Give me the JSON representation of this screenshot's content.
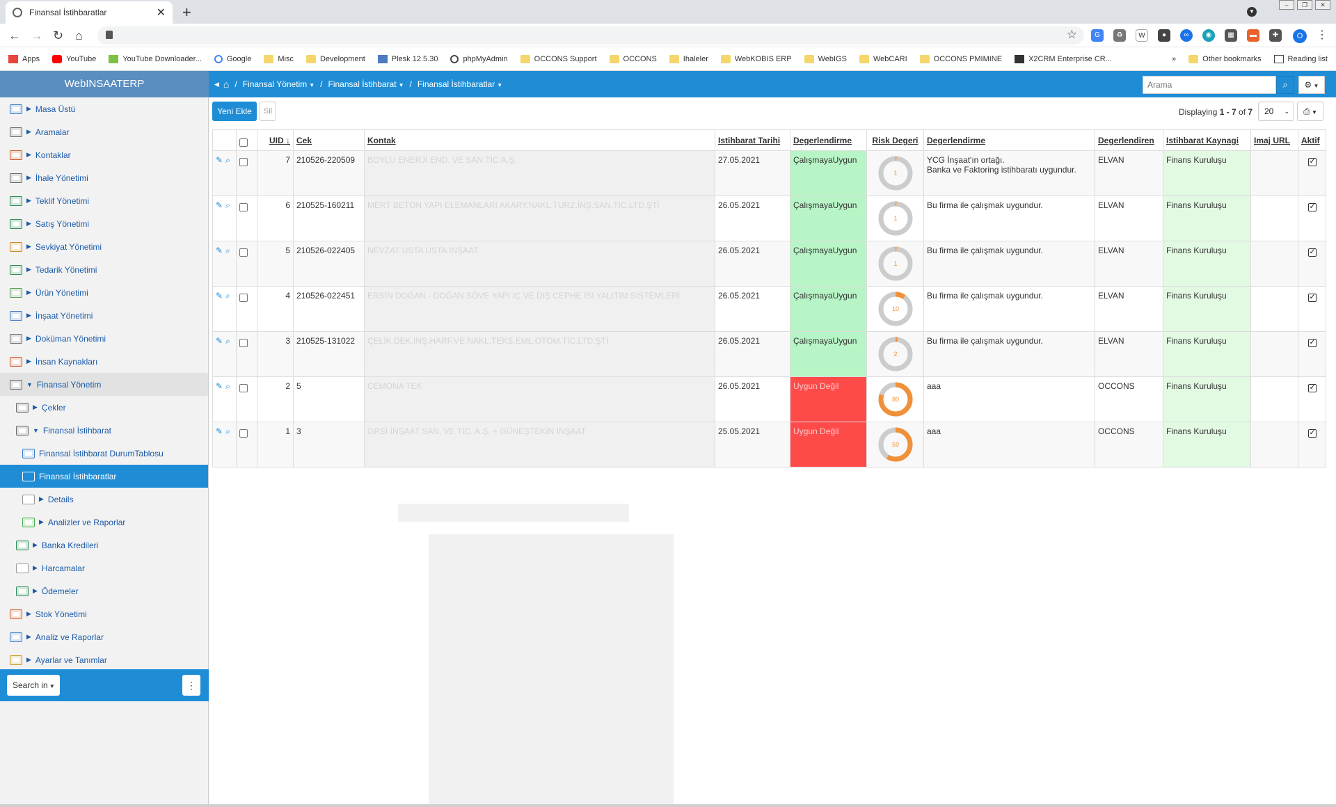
{
  "browser": {
    "tab_title": "Finansal İstihbaratlar",
    "bookmarks": [
      "Apps",
      "YouTube",
      "YouTube Downloader...",
      "Google",
      "Misc",
      "Development",
      "Plesk 12.5.30",
      "phpMyAdmin",
      "OCCONS Support",
      "OCCONS",
      "Ihaleler",
      "WebKOBIS ERP",
      "WebIGS",
      "WebCARI",
      "OCCONS PMIMINE",
      "X2CRM Enterprise CR..."
    ],
    "more_bookmarks": "»",
    "other_bookmarks": "Other bookmarks",
    "reading_list": "Reading list",
    "profile_initial": "O"
  },
  "app": {
    "brand": "WebINSAATERP",
    "breadcrumbs": [
      "Finansal Yönetim",
      "Finansal İstihbarat",
      "Finansal İstihbaratlar"
    ],
    "search_placeholder": "Arama"
  },
  "sidebar": {
    "items": [
      {
        "label": "Masa Üstü",
        "level": 0,
        "state": "closed"
      },
      {
        "label": "Aramalar",
        "level": 0,
        "state": "closed"
      },
      {
        "label": "Kontaklar",
        "level": 0,
        "state": "closed"
      },
      {
        "label": "İhale Yönetimi",
        "level": 0,
        "state": "closed"
      },
      {
        "label": "Teklif Yönetimi",
        "level": 0,
        "state": "closed"
      },
      {
        "label": "Satış Yönetimi",
        "level": 0,
        "state": "closed"
      },
      {
        "label": "Sevkiyat Yönetimi",
        "level": 0,
        "state": "closed"
      },
      {
        "label": "Tedarik Yönetimi",
        "level": 0,
        "state": "closed"
      },
      {
        "label": "Ürün Yönetimi",
        "level": 0,
        "state": "closed"
      },
      {
        "label": "İnşaat Yönetimi",
        "level": 0,
        "state": "closed"
      },
      {
        "label": "Doküman Yönetimi",
        "level": 0,
        "state": "closed"
      },
      {
        "label": "İnsan Kaynakları",
        "level": 0,
        "state": "closed"
      },
      {
        "label": "Finansal Yönetim",
        "level": 0,
        "state": "open"
      },
      {
        "label": "Çekler",
        "level": 1,
        "state": "closed"
      },
      {
        "label": "Finansal İstihbarat",
        "level": 1,
        "state": "open"
      },
      {
        "label": "Finansal İstihbarat DurumTablosu",
        "level": 2,
        "state": "leaf"
      },
      {
        "label": "Finansal İstihbaratlar",
        "level": 2,
        "state": "active"
      },
      {
        "label": "Details",
        "level": 2,
        "state": "closed"
      },
      {
        "label": "Analizler ve Raporlar",
        "level": 2,
        "state": "closed"
      },
      {
        "label": "Banka Kredileri",
        "level": 1,
        "state": "closed"
      },
      {
        "label": "Harcamalar",
        "level": 1,
        "state": "closed"
      },
      {
        "label": "Ödemeler",
        "level": 1,
        "state": "closed"
      },
      {
        "label": "Stok Yönetimi",
        "level": 0,
        "state": "closed"
      },
      {
        "label": "Analiz ve Raporlar",
        "level": 0,
        "state": "closed"
      },
      {
        "label": "Ayarlar ve Tanımlar",
        "level": 0,
        "state": "closed"
      }
    ],
    "search_in": "Search in"
  },
  "toolbar": {
    "new_label": "Yeni Ekle",
    "delete_label": "Sil",
    "displaying_prefix": "Displaying ",
    "displaying_range": "1 - 7",
    "displaying_of": " of ",
    "displaying_total": "7",
    "page_size": "20"
  },
  "table": {
    "columns": [
      "UID",
      "Cek",
      "Kontak",
      "Istihbarat Tarihi",
      "Degerlendirme",
      "Risk Degeri",
      "Degerlendirme",
      "Degerlendiren",
      "Istihbarat Kaynagi",
      "Imaj URL",
      "Aktif"
    ],
    "rows": [
      {
        "uid": "7",
        "cek": "210526-220509",
        "kontak": "BOYLU ENERJİ END. VE SAN.TİC.A.Ş.",
        "date": "27.05.2021",
        "eval": "ÇalışmayaUygun",
        "eval_ok": true,
        "risk": 1,
        "comment": "YCG İnşaat'ın ortağı.\nBanka ve Faktoring istihbaratı uygundur.",
        "evaluator": "ELVAN",
        "source": "Finans Kuruluşu",
        "image_url": "",
        "active": true
      },
      {
        "uid": "6",
        "cek": "210525-160211",
        "kontak": "MERT BETON YAPI ELEMANLARI AKARY.NAKL.TURZ.İNŞ.SAN.TİC.LTD.ŞTİ",
        "date": "26.05.2021",
        "eval": "ÇalışmayaUygun",
        "eval_ok": true,
        "risk": 1,
        "comment": "Bu firma ile çalışmak uygundur.",
        "evaluator": "ELVAN",
        "source": "Finans Kuruluşu",
        "image_url": "",
        "active": true
      },
      {
        "uid": "5",
        "cek": "210526-022405",
        "kontak": "NEVZAT USTA USTA İNŞAAT",
        "date": "26.05.2021",
        "eval": "ÇalışmayaUygun",
        "eval_ok": true,
        "risk": 1,
        "comment": "Bu firma ile çalışmak uygundur.",
        "evaluator": "ELVAN",
        "source": "Finans Kuruluşu",
        "image_url": "",
        "active": true
      },
      {
        "uid": "4",
        "cek": "210526-022451",
        "kontak": "ERSİN DOĞAN - DOĞAN SÖVE YAPI İÇ VE DIŞ CEPHE İSI YALITIM SİSTEMLERİ",
        "date": "26.05.2021",
        "eval": "ÇalışmayaUygun",
        "eval_ok": true,
        "risk": 10,
        "comment": "Bu firma ile çalışmak uygundur.",
        "evaluator": "ELVAN",
        "source": "Finans Kuruluşu",
        "image_url": "",
        "active": true
      },
      {
        "uid": "3",
        "cek": "210525-131022",
        "kontak": "ÇELİK DEK.İNŞ.HARF.VE NAKL.TEKS.EML.OTOM.TİC.LTD.ŞTİ",
        "date": "26.05.2021",
        "eval": "ÇalışmayaUygun",
        "eval_ok": true,
        "risk": 2,
        "comment": "Bu firma ile çalışmak uygundur.",
        "evaluator": "ELVAN",
        "source": "Finans Kuruluşu",
        "image_url": "",
        "active": true
      },
      {
        "uid": "2",
        "cek": "5",
        "kontak": "CEMONA TEK",
        "date": "26.05.2021",
        "eval": "Uygun Değil",
        "eval_ok": false,
        "risk": 80,
        "comment": "aaa",
        "evaluator": "OCCONS",
        "source": "Finans Kuruluşu",
        "image_url": "",
        "active": true
      },
      {
        "uid": "1",
        "cek": "3",
        "kontak": "GRSİ İNŞAAT SAN. VE TİC. A.Ş. + GÜNEŞTEKİN İNŞAAT",
        "date": "25.05.2021",
        "eval": "Uygun Değil",
        "eval_ok": false,
        "risk": 59,
        "comment": "aaa",
        "evaluator": "OCCONS",
        "source": "Finans Kuruluşu",
        "image_url": "",
        "active": true
      }
    ]
  },
  "colors": {
    "brand_blue": "#1f8dd6",
    "ok_green": "#b8f5c6",
    "bad_red": "#ff4a4a",
    "gauge_orange": "#f0913a",
    "gauge_gray": "#cccccc"
  }
}
